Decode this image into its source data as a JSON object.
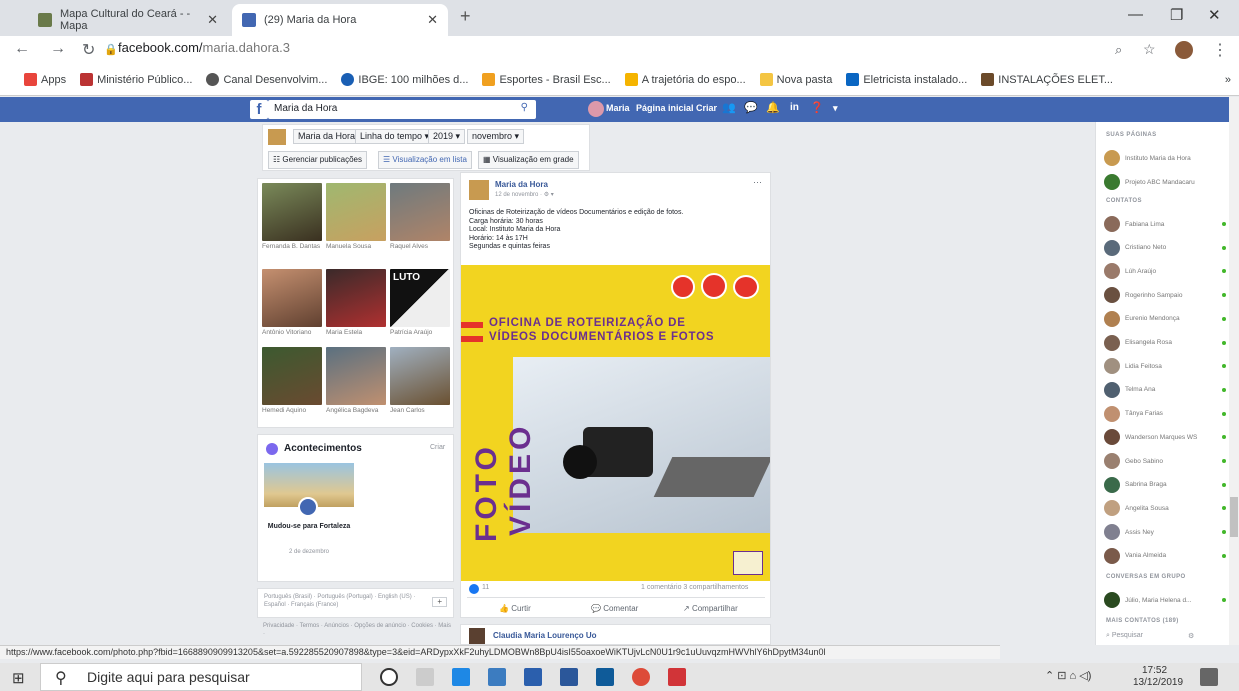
{
  "browser": {
    "tabs": [
      {
        "title": "Mapa Cultural do Ceará - - Mapa"
      },
      {
        "title": "(29) Maria da Hora"
      }
    ],
    "new_tab": "+",
    "url_host": "facebook.com/",
    "url_path": "maria.dahora.3",
    "bookmarks": [
      "Apps",
      "Ministério Público...",
      "Canal Desenvolvim...",
      "IBGE: 100 milhões d...",
      "Esportes - Brasil Esc...",
      "A trajetória do espo...",
      "Nova pasta",
      "Eletricista instalado...",
      "INSTALAÇÕES ELET..."
    ],
    "bookmarks_more": "»"
  },
  "fb": {
    "search": "Maria da Hora",
    "nav": [
      "Maria",
      "Página inicial",
      "Criar"
    ],
    "timeline_selectors": [
      "Maria da Hora",
      "Linha do tempo ▾",
      "2019 ▾",
      "novembro ▾"
    ],
    "buttons": [
      "Gerenciar publicações",
      "Visualização em lista",
      "Visualização em grade"
    ],
    "friends": [
      {
        "name": "Fernanda B. Dantas"
      },
      {
        "name": "Manuela Sousa"
      },
      {
        "name": "Raquel Alves"
      },
      {
        "name": "Antônio Vitoriano"
      },
      {
        "name": "Maria Estela"
      },
      {
        "name": "Patrícia Araújo"
      },
      {
        "name": "Hemedi Aquino"
      },
      {
        "name": "Angélica Bagdeva"
      },
      {
        "name": "Jean Carlos"
      }
    ],
    "luto": "LUTO",
    "events": {
      "title": "Acontecimentos",
      "action": "Criar",
      "item": "Mudou-se para Fortaleza",
      "date": "2 de dezembro"
    },
    "languages": "Português (Brasil) · Português (Portugal) · English (US) · Español · Français (France)",
    "footer": "Privacidade · Termos · Anúncios · Opções de anúncio · Cookies · Mais ·",
    "post": {
      "author": "Maria da Hora",
      "time": "12 de novembro · ⚙ ▾",
      "lines": [
        "Oficinas de Roteirização de vídeos Documentários e edição de fotos.",
        "Carga horária: 30 horas",
        "Local: Instituto Maria da Hora",
        "Horário: 14 às 17H",
        "Segundas e quintas feiras"
      ],
      "img_line1": "OFICINA DE ROTEIRIZAÇÃO DE",
      "img_line2": "VÍDEOS DOCUMENTÁRIOS E FOTOS",
      "img_vert1": "FOTO",
      "img_vert2": "VÍDEO",
      "likes": "11",
      "stats": "1 comentário  3 compartilhamentos",
      "actions": [
        "Curtir",
        "Comentar",
        "Compartilhar"
      ],
      "more": "···"
    },
    "next_post_author": "Claudia Maria Lourenço Uo",
    "right": {
      "pages_header": "SUAS PÁGINAS",
      "pages": [
        "Instituto Maria da Hora",
        "Projeto ABC Mandacaru"
      ],
      "contacts_header": "CONTATOS",
      "contacts": [
        "Fabiana Lima",
        "Cristiano Neto",
        "Lúh Araújo",
        "Rogerinho Sampaio",
        "Eurenio Mendonça",
        "Elisangela Rosa",
        "Lidia Feitosa",
        "Telma Ana",
        "Tânya Farias",
        "Wanderson Marques WS",
        "Gebo Sabino",
        "Sabrina Braga",
        "Angelita Sousa",
        "Assis Ney",
        "Vania Almeida"
      ],
      "group_header": "CONVERSAS EM GRUPO",
      "group": "Júlio, Maria Helena d...",
      "more_header": "MAIS CONTATOS (189)",
      "search": "Pesquisar"
    }
  },
  "status_url": "https://www.facebook.com/photo.php?fbid=1668890909913205&set=a.592285520907898&type=3&eid=ARDypxXkF2uhyLDMOBWn8BpU4isI55oaxoeWiKTUjvLcN0U1r9c1uUuvqzmHWVhlY6hDpytM34un0l",
  "taskbar": {
    "search": "Digite aqui para pesquisar",
    "time": "17:52",
    "date": "13/12/2019"
  },
  "colors": {
    "fb_blue": "#4267b2",
    "poster_yellow": "#f2d420",
    "poster_red": "#e5332a",
    "poster_purple": "#6b2f8f"
  }
}
